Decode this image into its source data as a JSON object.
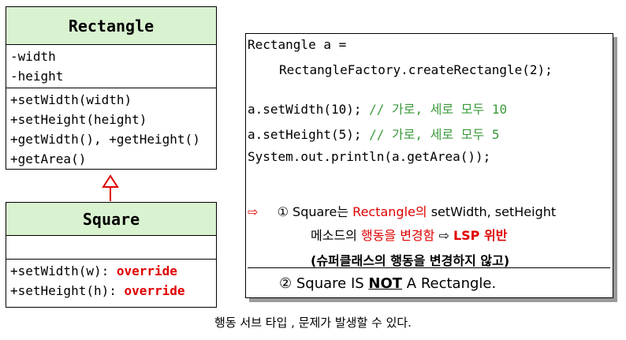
{
  "rectangle_class": {
    "name": "Rectangle",
    "attributes": [
      "-width",
      "-height"
    ],
    "methods": [
      "+setWidth(width)",
      "+setHeight(height)",
      "+getWidth(), +getHeight()",
      "+getArea()"
    ]
  },
  "square_class": {
    "name": "Square",
    "attributes": [],
    "methods": [
      {
        "sig": "+setWidth(w): ",
        "tag": "override"
      },
      {
        "sig": "+setHeight(h): ",
        "tag": "override"
      }
    ]
  },
  "code": {
    "line1": "Rectangle a =",
    "line2": "RectangleFactory.createRectangle(2);",
    "line3_code": "a.setWidth(10);",
    "line3_comment": " // 가로, 세로 모두 10",
    "line4_code": "a.setHeight(5);",
    "line4_comment": " // 가로, 세로 모두 5",
    "line5": "System.out.println(a.getArea());"
  },
  "notes": {
    "arrow": "⇨",
    "n1_num": "①",
    "n1_a": "Square는 ",
    "n1_b": "Rectangle의",
    "n1_c": " setWidth, setHeight",
    "n1_line2_a": "메소드의 ",
    "n1_line2_b": "행동을 변경함",
    "n1_line2_c": " ⇨ ",
    "n1_line2_d": "LSP 위반",
    "n1_line3": "(슈퍼클래스의 행동을 변경하지 않고)",
    "n2_num": "②",
    "n2_a": "Square IS ",
    "n2_b": "NOT",
    "n2_c": " A Rectangle."
  },
  "caption": "행동 서브 타입 , 문제가 발생할 수 있다."
}
